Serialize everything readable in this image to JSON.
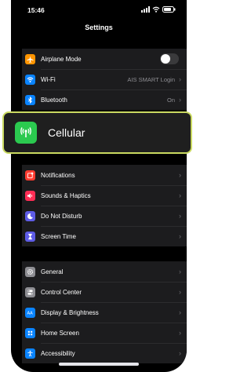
{
  "status_bar": {
    "time": "15:46"
  },
  "header": {
    "title": "Settings"
  },
  "group1": [
    {
      "label": "Airplane Mode",
      "icon": "airplane-icon",
      "color": "#ff9500",
      "toggle": false
    },
    {
      "label": "Wi-Fi",
      "icon": "wifi-icon",
      "color": "#0a84ff",
      "value": "AIS SMART Login"
    },
    {
      "label": "Bluetooth",
      "icon": "bluetooth-icon",
      "color": "#0a84ff",
      "value": "On"
    }
  ],
  "highlight": {
    "label": "Cellular",
    "icon": "cellular-antenna-icon",
    "color": "#2bc94f",
    "border": "#c9d960"
  },
  "group2": [
    {
      "label": "Notifications",
      "icon": "notifications-icon",
      "color": "#ff3b30"
    },
    {
      "label": "Sounds & Haptics",
      "icon": "speaker-icon",
      "color": "#ff2d55"
    },
    {
      "label": "Do Not Disturb",
      "icon": "moon-icon",
      "color": "#5e5ce6"
    },
    {
      "label": "Screen Time",
      "icon": "hourglass-icon",
      "color": "#5e5ce6"
    }
  ],
  "group3": [
    {
      "label": "General",
      "icon": "gear-icon",
      "color": "#8e8e93"
    },
    {
      "label": "Control Center",
      "icon": "toggles-icon",
      "color": "#8e8e93"
    },
    {
      "label": "Display & Brightness",
      "icon": "display-icon",
      "color": "#0a84ff"
    },
    {
      "label": "Home Screen",
      "icon": "home-grid-icon",
      "color": "#0a84ff"
    },
    {
      "label": "Accessibility",
      "icon": "accessibility-icon",
      "color": "#0a84ff"
    }
  ]
}
